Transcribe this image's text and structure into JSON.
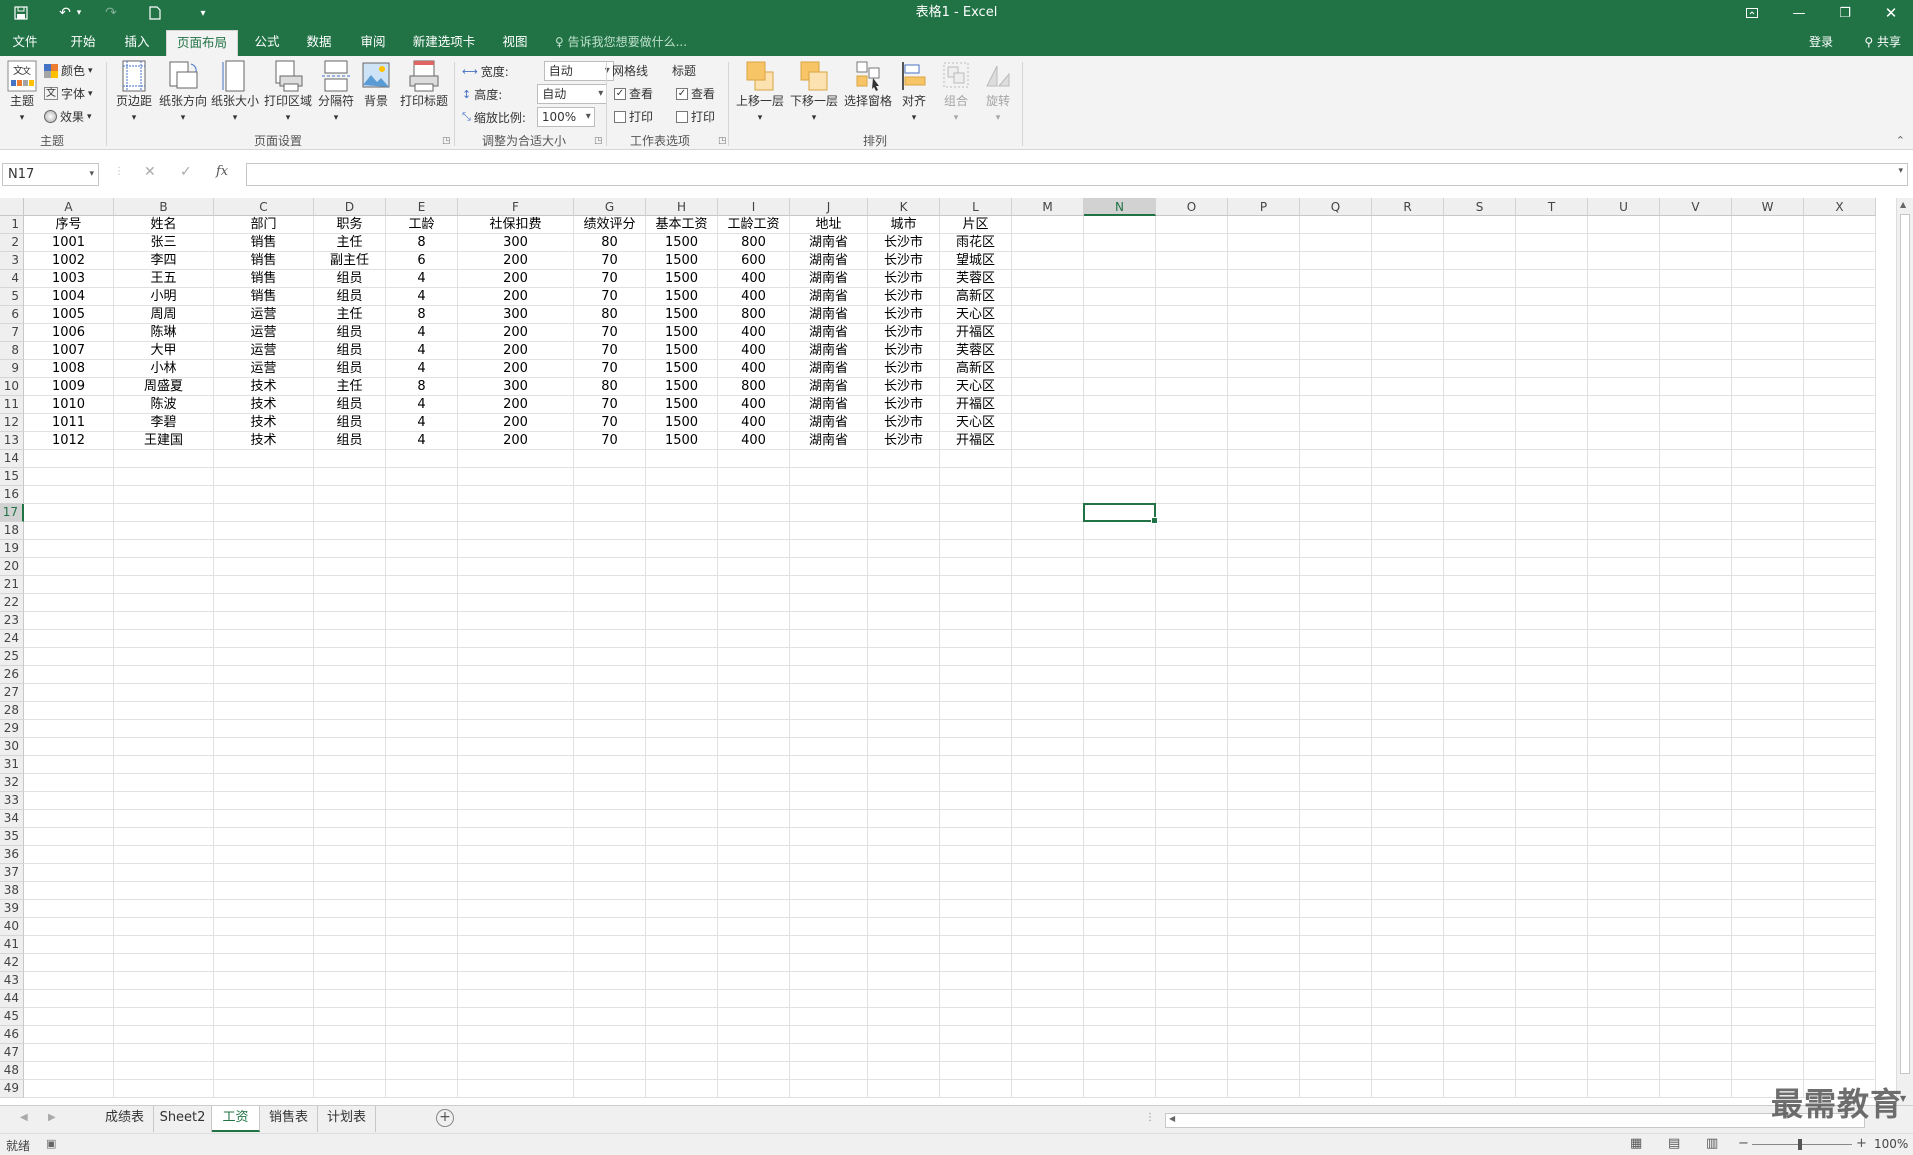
{
  "window": {
    "title": "表格1 - Excel"
  },
  "menu": {
    "tabs": [
      "文件",
      "开始",
      "插入",
      "页面布局",
      "公式",
      "数据",
      "审阅",
      "新建选项卡",
      "视图"
    ],
    "active_index": 3,
    "tell_me": "告诉我您想要做什么...",
    "login": "登录",
    "share": "共享"
  },
  "ribbon": {
    "theme": {
      "main": "主题",
      "colors": "颜色",
      "fonts": "字体",
      "effects": "效果",
      "group": "主题"
    },
    "page_setup": {
      "margins": "页边距",
      "orientation": "纸张方向",
      "size": "纸张大小",
      "print_area": "打印区域",
      "breaks": "分隔符",
      "background": "背景",
      "print_titles": "打印标题",
      "group": "页面设置"
    },
    "scale": {
      "width_label": "宽度:",
      "width_value": "自动",
      "height_label": "高度:",
      "height_value": "自动",
      "scale_label": "缩放比例:",
      "scale_value": "100%",
      "group": "调整为合适大小"
    },
    "sheet_options": {
      "gridlines": "网格线",
      "headings": "标题",
      "view": "查看",
      "print": "打印",
      "group": "工作表选项"
    },
    "arrange": {
      "bring_forward": "上移一层",
      "send_backward": "下移一层",
      "selection_pane": "选择窗格",
      "align": "对齐",
      "group_btn": "组合",
      "rotate": "旋转",
      "group": "排列"
    }
  },
  "formula_bar": {
    "name_box": "N17",
    "content": ""
  },
  "columns": [
    "A",
    "B",
    "C",
    "D",
    "E",
    "F",
    "G",
    "H",
    "I",
    "J",
    "K",
    "L",
    "M",
    "N",
    "O",
    "P",
    "Q",
    "R",
    "S",
    "T",
    "U",
    "V",
    "W",
    "X"
  ],
  "row_count": 49,
  "selected": {
    "col": "N",
    "row": 17
  },
  "table": {
    "header": [
      "序号",
      "姓名",
      "部门",
      "职务",
      "工龄",
      "社保扣费",
      "绩效评分",
      "基本工资",
      "工龄工资",
      "地址",
      "城市",
      "片区"
    ],
    "rows": [
      [
        "1001",
        "张三",
        "销售",
        "主任",
        "8",
        "300",
        "80",
        "1500",
        "800",
        "湖南省",
        "长沙市",
        "雨花区"
      ],
      [
        "1002",
        "李四",
        "销售",
        "副主任",
        "6",
        "200",
        "70",
        "1500",
        "600",
        "湖南省",
        "长沙市",
        "望城区"
      ],
      [
        "1003",
        "王五",
        "销售",
        "组员",
        "4",
        "200",
        "70",
        "1500",
        "400",
        "湖南省",
        "长沙市",
        "芙蓉区"
      ],
      [
        "1004",
        "小明",
        "销售",
        "组员",
        "4",
        "200",
        "70",
        "1500",
        "400",
        "湖南省",
        "长沙市",
        "高新区"
      ],
      [
        "1005",
        "周周",
        "运营",
        "主任",
        "8",
        "300",
        "80",
        "1500",
        "800",
        "湖南省",
        "长沙市",
        "天心区"
      ],
      [
        "1006",
        "陈琳",
        "运营",
        "组员",
        "4",
        "200",
        "70",
        "1500",
        "400",
        "湖南省",
        "长沙市",
        "开福区"
      ],
      [
        "1007",
        "大甲",
        "运营",
        "组员",
        "4",
        "200",
        "70",
        "1500",
        "400",
        "湖南省",
        "长沙市",
        "芙蓉区"
      ],
      [
        "1008",
        "小林",
        "运营",
        "组员",
        "4",
        "200",
        "70",
        "1500",
        "400",
        "湖南省",
        "长沙市",
        "高新区"
      ],
      [
        "1009",
        "周盛夏",
        "技术",
        "主任",
        "8",
        "300",
        "80",
        "1500",
        "800",
        "湖南省",
        "长沙市",
        "天心区"
      ],
      [
        "1010",
        "陈波",
        "技术",
        "组员",
        "4",
        "200",
        "70",
        "1500",
        "400",
        "湖南省",
        "长沙市",
        "开福区"
      ],
      [
        "1011",
        "李碧",
        "技术",
        "组员",
        "4",
        "200",
        "70",
        "1500",
        "400",
        "湖南省",
        "长沙市",
        "天心区"
      ],
      [
        "1012",
        "王建国",
        "技术",
        "组员",
        "4",
        "200",
        "70",
        "1500",
        "400",
        "湖南省",
        "长沙市",
        "开福区"
      ]
    ]
  },
  "sheets": [
    "成绩表",
    "Sheet2",
    "工资",
    "销售表",
    "计划表"
  ],
  "active_sheet": 2,
  "status": {
    "ready": "就绪",
    "zoom": "100%"
  },
  "watermark": "最需教育",
  "colors": {
    "accent": "#217346"
  }
}
